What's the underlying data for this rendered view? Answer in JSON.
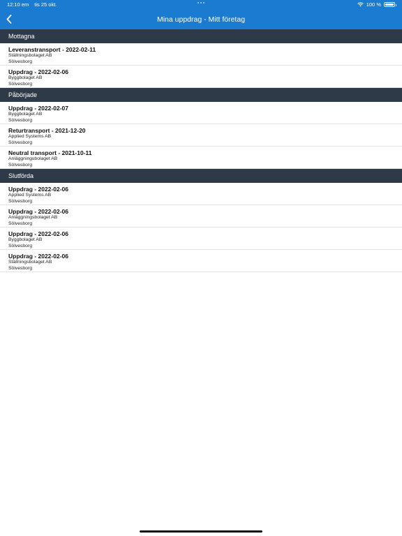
{
  "status": {
    "time": "12:10 em",
    "date": "tis 25 okt.",
    "battery": "100 %",
    "icons": {
      "wifi": "wifi-icon",
      "battery": "battery-icon"
    }
  },
  "nav": {
    "title": "Mina uppdrag - Mitt företag",
    "back_icon": "chevron-left-icon"
  },
  "colors": {
    "accent": "#1a7bd0",
    "section": "#2e3a47"
  },
  "sections": [
    {
      "title": "Mottagna",
      "items": [
        {
          "title": "Leveranstransport - 2022-02-11",
          "company": "Ställningsbolaget AB",
          "city": "Sölvesborg"
        },
        {
          "title": "Uppdrag - 2022-02-06",
          "company": "Byggbolaget AB",
          "city": "Sölvesborg"
        }
      ]
    },
    {
      "title": "Påbörjade",
      "items": [
        {
          "title": "Uppdrag - 2022-02-07",
          "company": "Byggbolaget AB",
          "city": "Sölvesborg"
        },
        {
          "title": "Returtransport - 2021-12-20",
          "company": "Applied Systems AB",
          "city": "Sölvesborg"
        },
        {
          "title": "Neutral transport - 2021-10-11",
          "company": "Anläggningsbolaget AB",
          "city": "Sölvesborg"
        }
      ]
    },
    {
      "title": "Slutförda",
      "items": [
        {
          "title": "Uppdrag - 2022-02-06",
          "company": "Applied Systems AB",
          "city": "Sölvesborg"
        },
        {
          "title": "Uppdrag - 2022-02-06",
          "company": "Anläggningsbolaget AB",
          "city": "Sölvesborg"
        },
        {
          "title": "Uppdrag - 2022-02-06",
          "company": "Byggbolaget AB",
          "city": "Sölvesborg"
        },
        {
          "title": "Uppdrag - 2022-02-06",
          "company": "Ställningsbolaget AB",
          "city": "Sölvesborg"
        }
      ]
    }
  ]
}
